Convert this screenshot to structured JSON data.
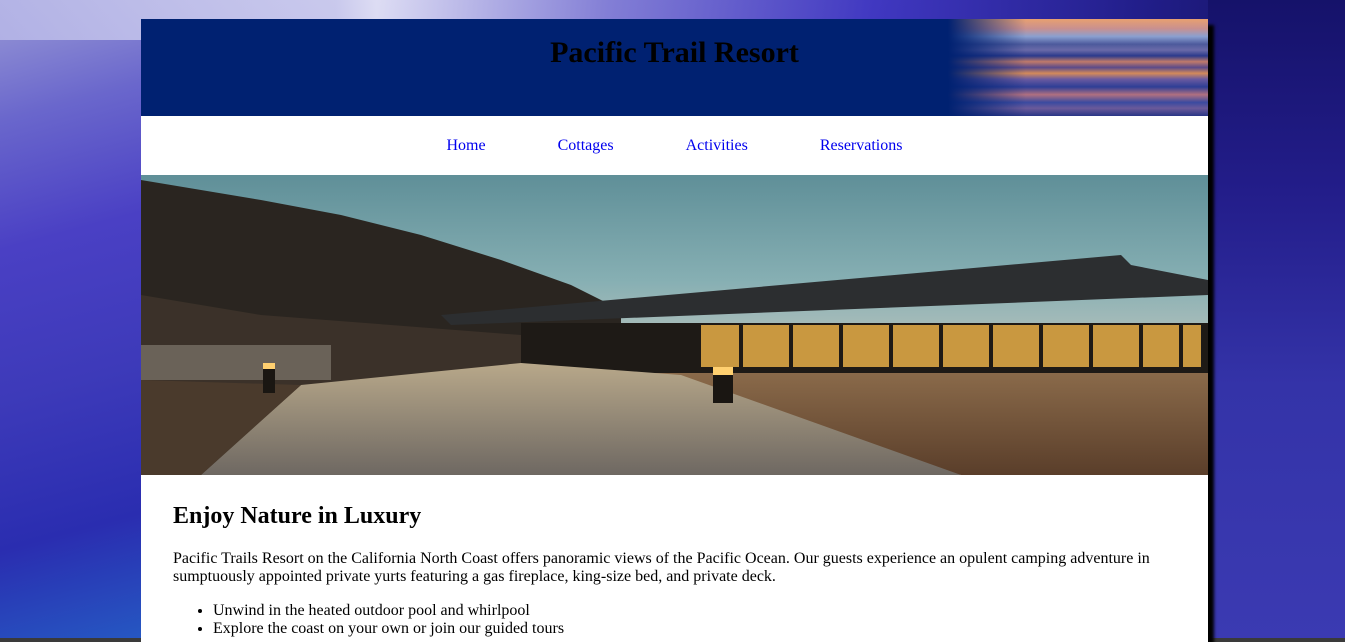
{
  "header": {
    "title": "Pacific Trail Resort"
  },
  "nav": {
    "items": [
      "Home",
      "Cottages",
      "Activities",
      "Reservations"
    ]
  },
  "main": {
    "heading": "Enjoy Nature in Luxury",
    "intro": "Pacific Trails Resort on the California North Coast offers panoramic views of the Pacific Ocean. Our guests experience an opulent camping adventure in sumptuously appointed private yurts featuring a gas fireplace, king-size bed, and private deck.",
    "features": [
      "Unwind in the heated outdoor pool and whirlpool",
      "Explore the coast on your own or join our guided tours"
    ]
  },
  "colors": {
    "header_bg": "#002171",
    "link": "#0000ee",
    "page_bg": "#ffffff"
  }
}
